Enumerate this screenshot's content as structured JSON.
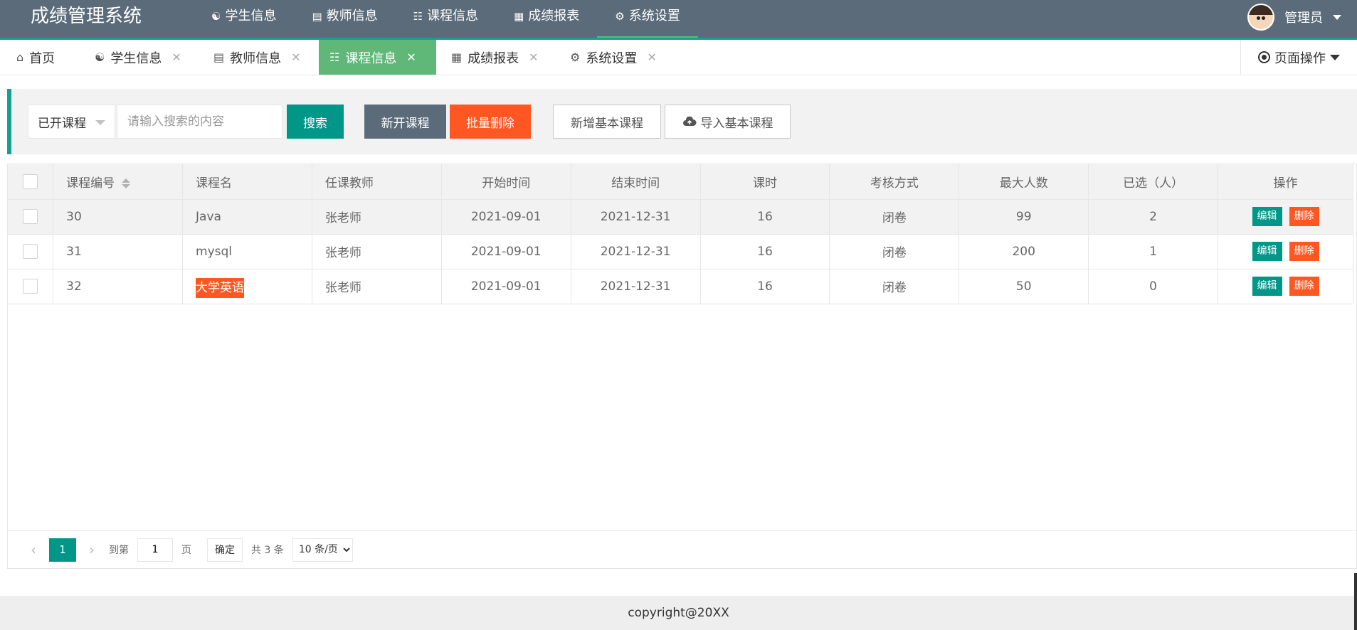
{
  "app": {
    "title": "成绩管理系统"
  },
  "header": {
    "nav": [
      {
        "label": "学生信息",
        "icon": "users-icon"
      },
      {
        "label": "教师信息",
        "icon": "clipboard-icon"
      },
      {
        "label": "课程信息",
        "icon": "book-icon"
      },
      {
        "label": "成绩报表",
        "icon": "table-icon"
      },
      {
        "label": "系统设置",
        "icon": "gear-icon"
      }
    ],
    "user": {
      "name": "管理员"
    }
  },
  "tabs": {
    "items": [
      {
        "label": "首页",
        "icon": "home-icon"
      },
      {
        "label": "学生信息",
        "icon": "users-icon"
      },
      {
        "label": "教师信息",
        "icon": "clipboard-icon"
      },
      {
        "label": "课程信息",
        "icon": "book-icon",
        "active": true
      },
      {
        "label": "成绩报表",
        "icon": "table-icon"
      },
      {
        "label": "系统设置",
        "icon": "gear-icon"
      }
    ],
    "page_ops": "页面操作"
  },
  "toolbar": {
    "select_value": "已开课程",
    "search_placeholder": "请输入搜索的内容",
    "search_label": "搜索",
    "new_course_label": "新开课程",
    "batch_delete_label": "批量删除",
    "add_base_label": "新增基本课程",
    "import_base_label": "导入基本课程"
  },
  "table": {
    "columns": [
      "课程编号",
      "课程名",
      "任课教师",
      "开始时间",
      "结束时间",
      "课时",
      "考核方式",
      "最大人数",
      "已选（人）",
      "操作"
    ],
    "rows": [
      {
        "id": "30",
        "name": "Java",
        "teacher": "张老师",
        "start": "2021-09-01",
        "end": "2021-12-31",
        "hours": "16",
        "exam": "闭卷",
        "max": "99",
        "selected": "2"
      },
      {
        "id": "31",
        "name": "mysql",
        "teacher": "张老师",
        "start": "2021-09-01",
        "end": "2021-12-31",
        "hours": "16",
        "exam": "闭卷",
        "max": "200",
        "selected": "1"
      },
      {
        "id": "32",
        "name": "大学英语",
        "teacher": "张老师",
        "start": "2021-09-01",
        "end": "2021-12-31",
        "hours": "16",
        "exam": "闭卷",
        "max": "50",
        "selected": "0"
      }
    ],
    "edit_label": "编辑",
    "delete_label": "删除"
  },
  "pager": {
    "current": "1",
    "goto_label": "到第",
    "goto_value": "1",
    "page_label": "页",
    "confirm_label": "确定",
    "total_label": "共 3 条",
    "page_size": "10 条/页"
  },
  "footer": {
    "copyright": "copyright@20XX"
  },
  "colors": {
    "header": "#5b6b79",
    "accent": "#16a092",
    "active_tab": "#5fb878",
    "primary": "#009688",
    "danger": "#ff5722"
  }
}
